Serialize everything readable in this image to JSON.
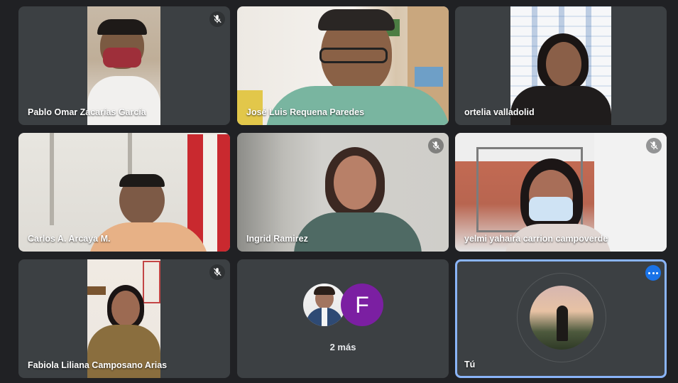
{
  "participants": [
    {
      "name": "Pablo Omar Zacarías García",
      "muted": true
    },
    {
      "name": "José Luis Requena Paredes",
      "muted": false
    },
    {
      "name": "ortelia valladolid",
      "muted": false
    },
    {
      "name": "Carlos A. Arcaya M.",
      "muted": false
    },
    {
      "name": "Ingrid Ramirez",
      "muted": true
    },
    {
      "name": "yelmi yahaira carrion campoverde",
      "muted": true
    },
    {
      "name": "Fabiola Liliana Camposano Arias",
      "muted": true
    }
  ],
  "overflow": {
    "label": "2 más",
    "initial_letter": "F",
    "initial_color": "#7b1fa2"
  },
  "self": {
    "label": "Tú"
  },
  "icons": {
    "mute": "mic-off-icon",
    "more": "more-options-icon"
  },
  "colors": {
    "background": "#202124",
    "tile": "#3c4043",
    "self_border": "#8ab4f8",
    "accent": "#1a73e8"
  }
}
